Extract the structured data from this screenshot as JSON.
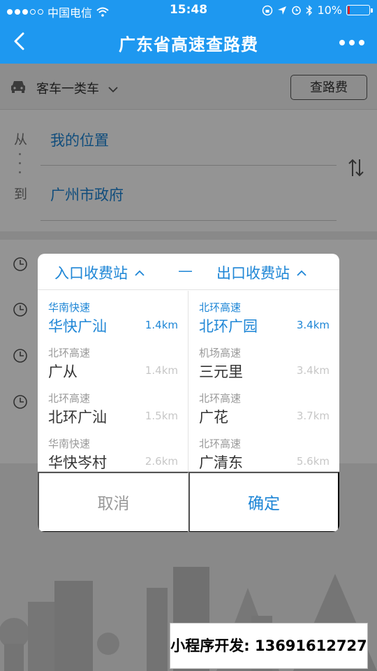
{
  "status": {
    "carrier": "中国电信",
    "time": "15:48",
    "battery": "10%",
    "battery_level": 0.1
  },
  "nav": {
    "title": "广东省高速查路费"
  },
  "vehicle": {
    "type": "客车一类车",
    "query_label": "查路费"
  },
  "route": {
    "from_label": "从",
    "from_value": "我的位置",
    "to_label": "到",
    "to_value": "广州市政府"
  },
  "modal": {
    "entry_title": "入口收费站",
    "separator": "—",
    "exit_title": "出口收费站",
    "entry_items": [
      {
        "road": "华南快速",
        "name": "华快广汕",
        "dist": "1.4km"
      },
      {
        "road": "北环高速",
        "name": "广从",
        "dist": "1.4km"
      },
      {
        "road": "北环高速",
        "name": "北环广汕",
        "dist": "1.5km"
      },
      {
        "road": "华南快速",
        "name": "华快岑村",
        "dist": "2.6km"
      }
    ],
    "exit_items": [
      {
        "road": "北环高速",
        "name": "北环广园",
        "dist": "3.4km"
      },
      {
        "road": "机场高速",
        "name": "三元里",
        "dist": "3.4km"
      },
      {
        "road": "北环高速",
        "name": "广花",
        "dist": "3.7km"
      },
      {
        "road": "北环高速",
        "name": "广清东",
        "dist": "5.6km"
      }
    ],
    "cancel_label": "取消",
    "confirm_label": "确定"
  },
  "promo": {
    "text": "小程序开发: 13691612727"
  },
  "colors": {
    "accent": "#1e98f0",
    "link": "#1e86d6"
  },
  "icons": [
    "wifi-icon",
    "back-icon",
    "more-icon",
    "car-icon",
    "chevron-down-icon",
    "swap-icon",
    "clock-icon",
    "chevron-up-icon",
    "location-arrow-icon",
    "alarm-icon",
    "bluetooth-icon",
    "battery-icon"
  ]
}
